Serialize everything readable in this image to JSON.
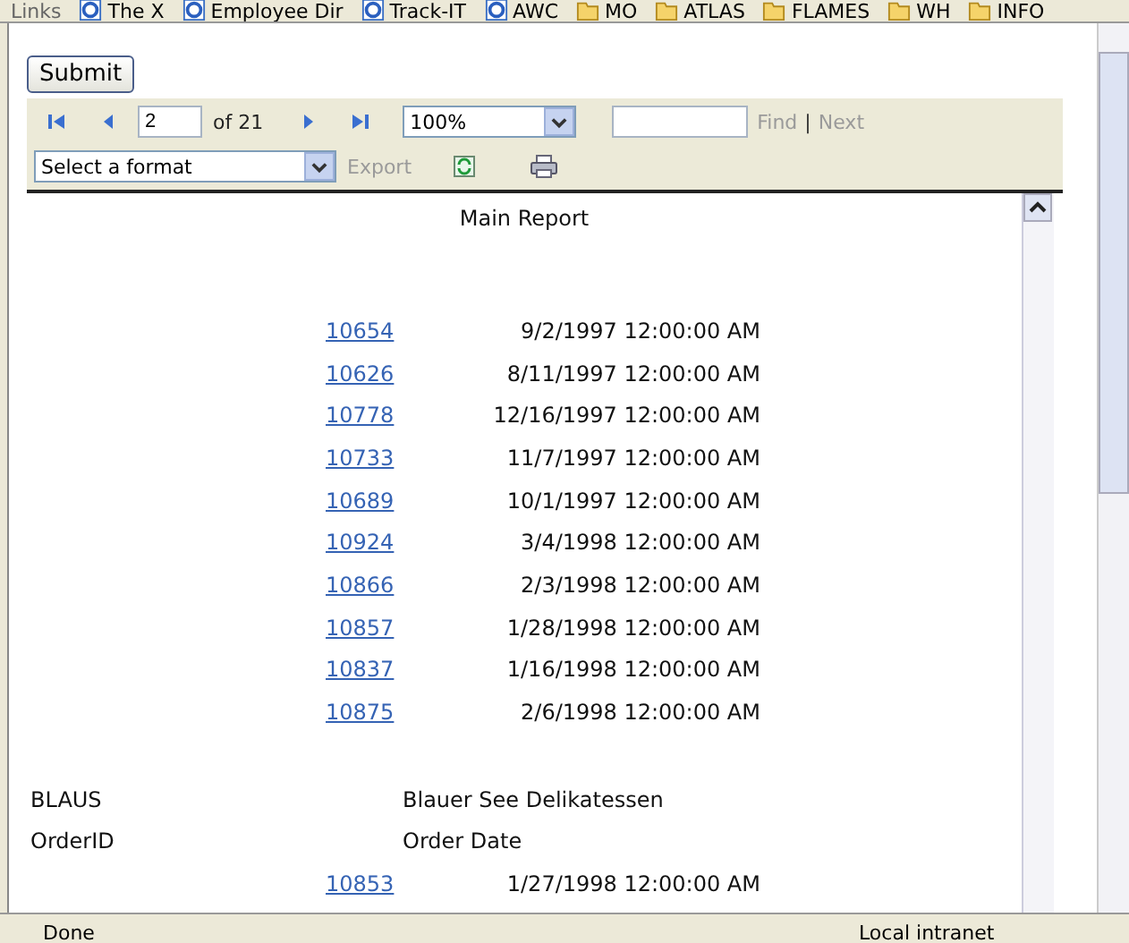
{
  "links_bar": {
    "label": "Links",
    "items": [
      {
        "label": "The X",
        "kind": "page"
      },
      {
        "label": "Employee Dir",
        "kind": "page"
      },
      {
        "label": "Track-IT",
        "kind": "page"
      },
      {
        "label": "AWC",
        "kind": "page"
      },
      {
        "label": "MO",
        "kind": "folder"
      },
      {
        "label": "ATLAS",
        "kind": "folder"
      },
      {
        "label": "FLAMES",
        "kind": "folder"
      },
      {
        "label": "WH",
        "kind": "folder"
      },
      {
        "label": "INFO",
        "kind": "folder"
      }
    ]
  },
  "submit_button": "Submit",
  "toolbar": {
    "page": "2",
    "page_count": "of 21",
    "zoom": "100%",
    "find": "Find",
    "separator": "|",
    "next": "Next",
    "format": "Select a format",
    "export": "Export"
  },
  "report": {
    "title": "Main Report",
    "rows": [
      {
        "order_id": "10654",
        "order_date": "9/2/1997 12:00:00 AM"
      },
      {
        "order_id": "10626",
        "order_date": "8/11/1997 12:00:00 AM"
      },
      {
        "order_id": "10778",
        "order_date": "12/16/1997 12:00:00 AM"
      },
      {
        "order_id": "10733",
        "order_date": "11/7/1997 12:00:00 AM"
      },
      {
        "order_id": "10689",
        "order_date": "10/1/1997 12:00:00 AM"
      },
      {
        "order_id": "10924",
        "order_date": "3/4/1998 12:00:00 AM"
      },
      {
        "order_id": "10866",
        "order_date": "2/3/1998 12:00:00 AM"
      },
      {
        "order_id": "10857",
        "order_date": "1/28/1998 12:00:00 AM"
      },
      {
        "order_id": "10837",
        "order_date": "1/16/1998 12:00:00 AM"
      },
      {
        "order_id": "10875",
        "order_date": "2/6/1998 12:00:00 AM"
      }
    ],
    "customer_id": "BLAUS",
    "customer_name": "Blauer See Delikatessen",
    "column_1": "OrderID",
    "column_2": "Order Date",
    "rows_2": [
      {
        "order_id": "10853",
        "order_date": "1/27/1998 12:00:00 AM"
      }
    ]
  },
  "status_bar": {
    "status": "Done",
    "zone": "Local intranet"
  }
}
